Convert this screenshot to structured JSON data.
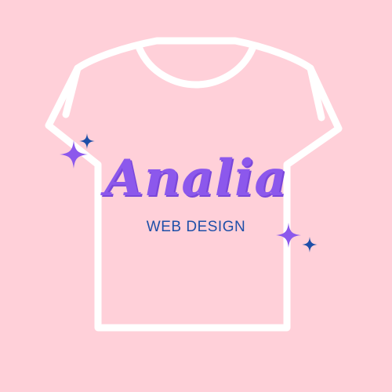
{
  "logo": {
    "brand_name": "Analia",
    "tagline": "WEB DESIGN",
    "background_color": "#ffd0d9",
    "brand_color": "#8c58ec",
    "tagline_color": "#1e4fa8",
    "accent_color": "#1e4fa8",
    "outline_color": "#ffffff",
    "icons": [
      "t-shirt-icon",
      "sparkle-icon",
      "sparkle-icon",
      "sparkle-icon",
      "sparkle-icon"
    ]
  }
}
